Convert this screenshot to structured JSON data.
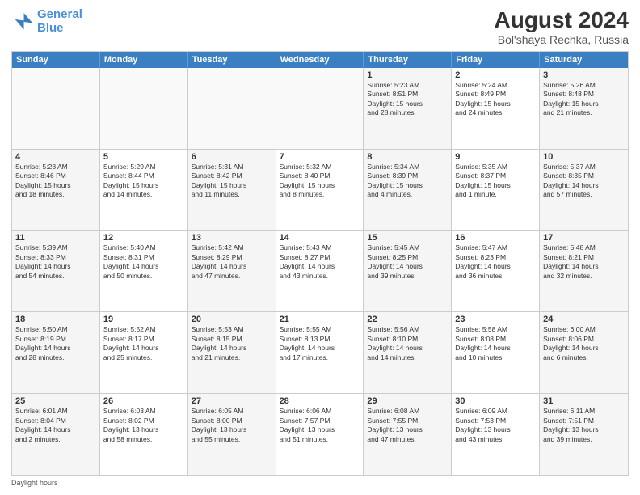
{
  "header": {
    "logo_line1": "General",
    "logo_line2": "Blue",
    "title": "August 2024",
    "subtitle": "Bol'shaya Rechka, Russia"
  },
  "days_of_week": [
    "Sunday",
    "Monday",
    "Tuesday",
    "Wednesday",
    "Thursday",
    "Friday",
    "Saturday"
  ],
  "footer": "Daylight hours",
  "weeks": [
    [
      {
        "day": "",
        "info": ""
      },
      {
        "day": "",
        "info": ""
      },
      {
        "day": "",
        "info": ""
      },
      {
        "day": "",
        "info": ""
      },
      {
        "day": "1",
        "info": "Sunrise: 5:23 AM\nSunset: 8:51 PM\nDaylight: 15 hours\nand 28 minutes."
      },
      {
        "day": "2",
        "info": "Sunrise: 5:24 AM\nSunset: 8:49 PM\nDaylight: 15 hours\nand 24 minutes."
      },
      {
        "day": "3",
        "info": "Sunrise: 5:26 AM\nSunset: 8:48 PM\nDaylight: 15 hours\nand 21 minutes."
      }
    ],
    [
      {
        "day": "4",
        "info": "Sunrise: 5:28 AM\nSunset: 8:46 PM\nDaylight: 15 hours\nand 18 minutes."
      },
      {
        "day": "5",
        "info": "Sunrise: 5:29 AM\nSunset: 8:44 PM\nDaylight: 15 hours\nand 14 minutes."
      },
      {
        "day": "6",
        "info": "Sunrise: 5:31 AM\nSunset: 8:42 PM\nDaylight: 15 hours\nand 11 minutes."
      },
      {
        "day": "7",
        "info": "Sunrise: 5:32 AM\nSunset: 8:40 PM\nDaylight: 15 hours\nand 8 minutes."
      },
      {
        "day": "8",
        "info": "Sunrise: 5:34 AM\nSunset: 8:39 PM\nDaylight: 15 hours\nand 4 minutes."
      },
      {
        "day": "9",
        "info": "Sunrise: 5:35 AM\nSunset: 8:37 PM\nDaylight: 15 hours\nand 1 minute."
      },
      {
        "day": "10",
        "info": "Sunrise: 5:37 AM\nSunset: 8:35 PM\nDaylight: 14 hours\nand 57 minutes."
      }
    ],
    [
      {
        "day": "11",
        "info": "Sunrise: 5:39 AM\nSunset: 8:33 PM\nDaylight: 14 hours\nand 54 minutes."
      },
      {
        "day": "12",
        "info": "Sunrise: 5:40 AM\nSunset: 8:31 PM\nDaylight: 14 hours\nand 50 minutes."
      },
      {
        "day": "13",
        "info": "Sunrise: 5:42 AM\nSunset: 8:29 PM\nDaylight: 14 hours\nand 47 minutes."
      },
      {
        "day": "14",
        "info": "Sunrise: 5:43 AM\nSunset: 8:27 PM\nDaylight: 14 hours\nand 43 minutes."
      },
      {
        "day": "15",
        "info": "Sunrise: 5:45 AM\nSunset: 8:25 PM\nDaylight: 14 hours\nand 39 minutes."
      },
      {
        "day": "16",
        "info": "Sunrise: 5:47 AM\nSunset: 8:23 PM\nDaylight: 14 hours\nand 36 minutes."
      },
      {
        "day": "17",
        "info": "Sunrise: 5:48 AM\nSunset: 8:21 PM\nDaylight: 14 hours\nand 32 minutes."
      }
    ],
    [
      {
        "day": "18",
        "info": "Sunrise: 5:50 AM\nSunset: 8:19 PM\nDaylight: 14 hours\nand 28 minutes."
      },
      {
        "day": "19",
        "info": "Sunrise: 5:52 AM\nSunset: 8:17 PM\nDaylight: 14 hours\nand 25 minutes."
      },
      {
        "day": "20",
        "info": "Sunrise: 5:53 AM\nSunset: 8:15 PM\nDaylight: 14 hours\nand 21 minutes."
      },
      {
        "day": "21",
        "info": "Sunrise: 5:55 AM\nSunset: 8:13 PM\nDaylight: 14 hours\nand 17 minutes."
      },
      {
        "day": "22",
        "info": "Sunrise: 5:56 AM\nSunset: 8:10 PM\nDaylight: 14 hours\nand 14 minutes."
      },
      {
        "day": "23",
        "info": "Sunrise: 5:58 AM\nSunset: 8:08 PM\nDaylight: 14 hours\nand 10 minutes."
      },
      {
        "day": "24",
        "info": "Sunrise: 6:00 AM\nSunset: 8:06 PM\nDaylight: 14 hours\nand 6 minutes."
      }
    ],
    [
      {
        "day": "25",
        "info": "Sunrise: 6:01 AM\nSunset: 8:04 PM\nDaylight: 14 hours\nand 2 minutes."
      },
      {
        "day": "26",
        "info": "Sunrise: 6:03 AM\nSunset: 8:02 PM\nDaylight: 13 hours\nand 58 minutes."
      },
      {
        "day": "27",
        "info": "Sunrise: 6:05 AM\nSunset: 8:00 PM\nDaylight: 13 hours\nand 55 minutes."
      },
      {
        "day": "28",
        "info": "Sunrise: 6:06 AM\nSunset: 7:57 PM\nDaylight: 13 hours\nand 51 minutes."
      },
      {
        "day": "29",
        "info": "Sunrise: 6:08 AM\nSunset: 7:55 PM\nDaylight: 13 hours\nand 47 minutes."
      },
      {
        "day": "30",
        "info": "Sunrise: 6:09 AM\nSunset: 7:53 PM\nDaylight: 13 hours\nand 43 minutes."
      },
      {
        "day": "31",
        "info": "Sunrise: 6:11 AM\nSunset: 7:51 PM\nDaylight: 13 hours\nand 39 minutes."
      }
    ]
  ]
}
